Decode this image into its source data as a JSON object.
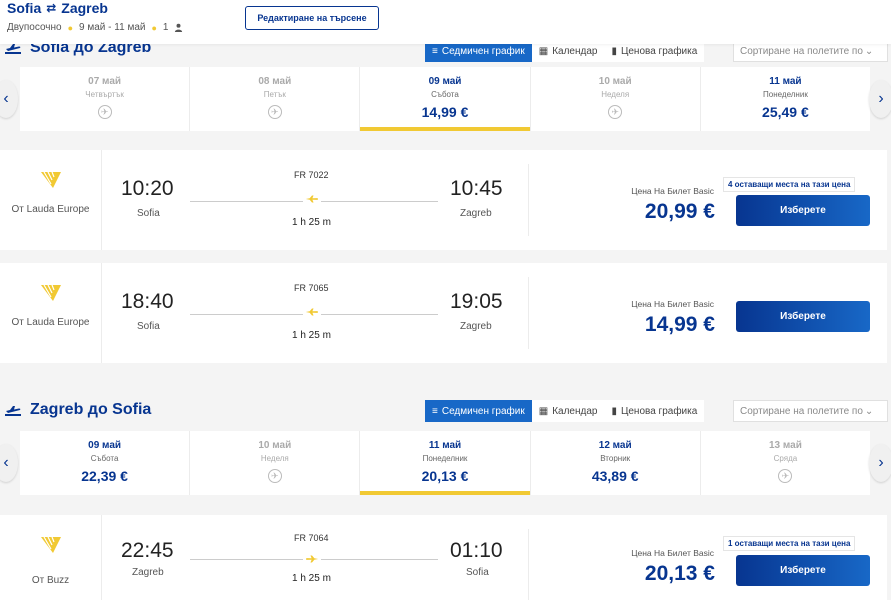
{
  "header": {
    "origin": "Sofia",
    "destination": "Zagreb",
    "trip_type": "Двупосочно",
    "dates": "9 май - 11 май",
    "passengers": "1",
    "edit_button": "Редактиране на търсене"
  },
  "view_tabs": {
    "weekly": "Седмичен график",
    "calendar": "Календар",
    "price_chart": "Ценова графика",
    "sort_placeholder": "Сортиране на полетите по"
  },
  "outbound": {
    "title": "Sofia до Zagreb",
    "days": [
      {
        "date": "07 май",
        "weekday": "Четвъртък",
        "price": "",
        "disabled": true
      },
      {
        "date": "08 май",
        "weekday": "Петък",
        "price": "",
        "disabled": true
      },
      {
        "date": "09 май",
        "weekday": "Събота",
        "price": "14,99 €",
        "disabled": false,
        "selected": true
      },
      {
        "date": "10 май",
        "weekday": "Неделя",
        "price": "",
        "disabled": true
      },
      {
        "date": "11 май",
        "weekday": "Понеделник",
        "price": "25,49 €",
        "disabled": false
      }
    ],
    "flights": [
      {
        "carrier": "От Lauda Europe",
        "dep_time": "10:20",
        "dep_city": "Sofia",
        "arr_time": "10:45",
        "arr_city": "Zagreb",
        "flight_no": "FR 7022",
        "duration": "1 h 25 m",
        "fare_label": "Цена На Билет Basic",
        "price": "20,99 €",
        "seats": "4 оставащи места на тази цена",
        "select": "Изберете"
      },
      {
        "carrier": "От Lauda Europe",
        "dep_time": "18:40",
        "dep_city": "Sofia",
        "arr_time": "19:05",
        "arr_city": "Zagreb",
        "flight_no": "FR 7065",
        "duration": "1 h 25 m",
        "fare_label": "Цена На Билет Basic",
        "price": "14,99 €",
        "seats": "",
        "select": "Изберете"
      }
    ]
  },
  "inbound": {
    "title": "Zagreb до Sofia",
    "days": [
      {
        "date": "09 май",
        "weekday": "Събота",
        "price": "22,39 €",
        "disabled": false
      },
      {
        "date": "10 май",
        "weekday": "Неделя",
        "price": "",
        "disabled": true
      },
      {
        "date": "11 май",
        "weekday": "Понеделник",
        "price": "20,13 €",
        "disabled": false,
        "selected": true
      },
      {
        "date": "12 май",
        "weekday": "Вторник",
        "price": "43,89 €",
        "disabled": false
      },
      {
        "date": "13 май",
        "weekday": "Сряда",
        "price": "",
        "disabled": true
      }
    ],
    "flights": [
      {
        "carrier": "От Buzz",
        "dep_time": "22:45",
        "dep_city": "Zagreb",
        "arr_time": "01:10",
        "arr_city": "Sofia",
        "flight_no": "FR 7064",
        "duration": "1 h 25 m",
        "fare_label": "Цена На Билет Basic",
        "price": "20,13 €",
        "seats": "1 оставащи места на тази цена",
        "select": "Изберете"
      }
    ]
  },
  "colors": {
    "brand_blue": "#073590",
    "accent_blue": "#1868c7",
    "yellow": "#f1c933"
  }
}
